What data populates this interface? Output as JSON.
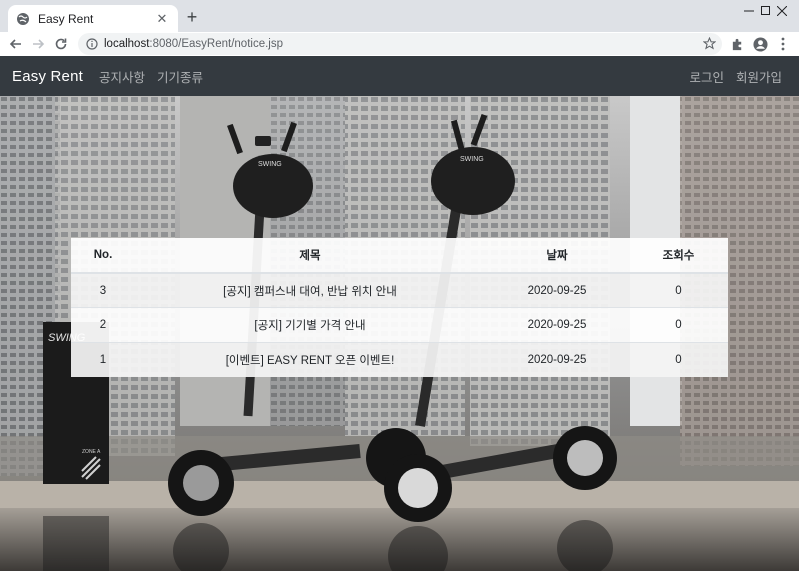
{
  "browser": {
    "tab_title": "Easy Rent",
    "tab_close": "✕",
    "new_tab": "+",
    "url_host": "localhost",
    "url_rest": ":8080/EasyRent/notice.jsp"
  },
  "navbar": {
    "brand": "Easy Rent",
    "left_links": [
      "공지사항",
      "기기종류"
    ],
    "right_links": [
      "로그인",
      "회원가입"
    ],
    "bg_color": "#343a40"
  },
  "notice_table": {
    "headers": {
      "no": "No.",
      "title": "제목",
      "date": "날짜",
      "views": "조회수"
    },
    "rows": [
      {
        "no": "3",
        "title": "[공지] 캠퍼스내 대여, 반납 위치 안내",
        "date": "2020-09-25",
        "views": "0"
      },
      {
        "no": "2",
        "title": "[공지] 기기별 가격 안내",
        "date": "2020-09-25",
        "views": "0"
      },
      {
        "no": "1",
        "title": "[이벤트] EASY RENT 오픈 이벤트!",
        "date": "2020-09-25",
        "views": "0"
      }
    ]
  },
  "hero_signage": {
    "board_text": "SWING",
    "board_zone": "ZONE A",
    "helmet_text": "SWING"
  },
  "icons": {
    "favicon": "globe-icon",
    "back": "arrow-left-icon",
    "forward": "arrow-right-icon",
    "reload": "reload-icon",
    "site_info": "info-icon",
    "bookmark": "star-icon",
    "extensions": "puzzle-icon",
    "profile": "account-icon",
    "menu": "kebab-menu-icon"
  }
}
